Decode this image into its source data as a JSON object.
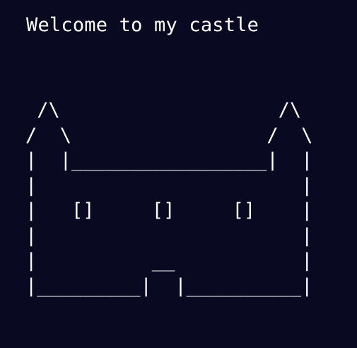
{
  "terminal": {
    "background": "#090a22",
    "foreground": "#ffffff",
    "greeting": "Welcome to my castle",
    "castle_lines": [
      " /\\                   /\\",
      "/  \\                 /  \\",
      "|  |_________________|  |",
      "|                       |",
      "|   []     []     []    |",
      "|                       |",
      "|          __           |",
      "|_________|  |__________|"
    ]
  }
}
